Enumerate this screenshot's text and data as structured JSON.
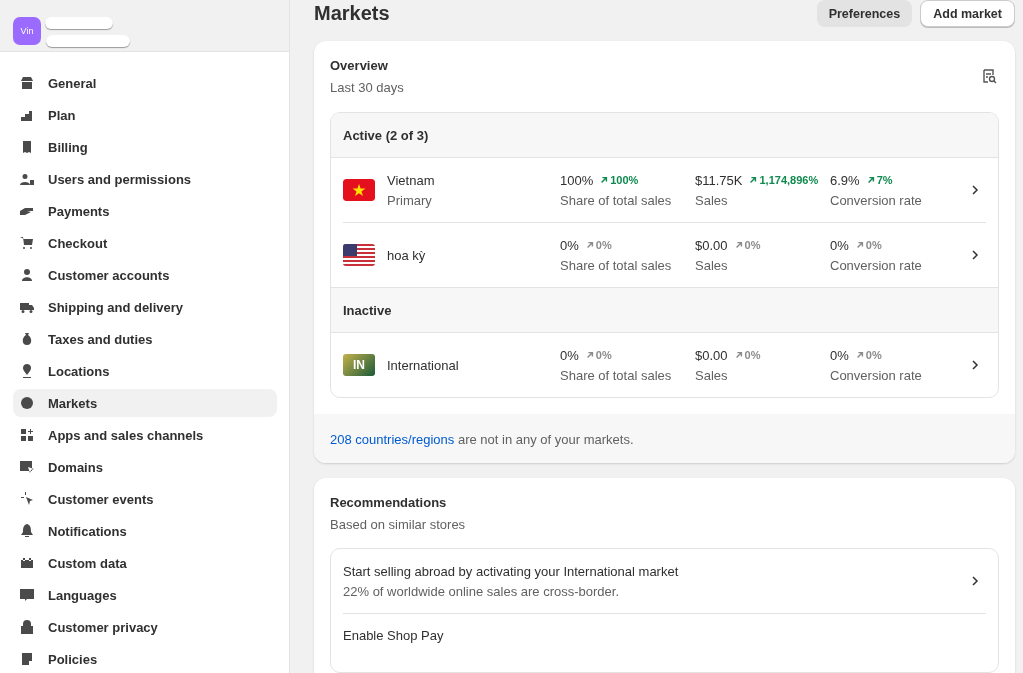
{
  "store": {
    "avatar": "Vin"
  },
  "sidebar": {
    "items": [
      {
        "label": "General",
        "selected": false
      },
      {
        "label": "Plan",
        "selected": false
      },
      {
        "label": "Billing",
        "selected": false
      },
      {
        "label": "Users and permissions",
        "selected": false
      },
      {
        "label": "Payments",
        "selected": false
      },
      {
        "label": "Checkout",
        "selected": false
      },
      {
        "label": "Customer accounts",
        "selected": false
      },
      {
        "label": "Shipping and delivery",
        "selected": false
      },
      {
        "label": "Taxes and duties",
        "selected": false
      },
      {
        "label": "Locations",
        "selected": false
      },
      {
        "label": "Markets",
        "selected": true
      },
      {
        "label": "Apps and sales channels",
        "selected": false
      },
      {
        "label": "Domains",
        "selected": false
      },
      {
        "label": "Customer events",
        "selected": false
      },
      {
        "label": "Notifications",
        "selected": false
      },
      {
        "label": "Custom data",
        "selected": false
      },
      {
        "label": "Languages",
        "selected": false
      },
      {
        "label": "Customer privacy",
        "selected": false
      },
      {
        "label": "Policies",
        "selected": false
      }
    ]
  },
  "page": {
    "title": "Markets",
    "buttons": [
      {
        "label": "Preferences",
        "kind": "secondary"
      },
      {
        "label": "Add market",
        "kind": "primary"
      }
    ]
  },
  "overview": {
    "title": "Overview",
    "subtitle": "Last 30 days",
    "groups": [
      {
        "heading": "Active (2 of 3)",
        "markets": [
          {
            "name": "Vietnam",
            "note": "Primary",
            "kind": "vn",
            "metrics": [
              {
                "value": "100%",
                "change": "100%",
                "positive": true,
                "label": "Share of total sales"
              },
              {
                "value": "$11.75K",
                "change": "1,174,896%",
                "positive": true,
                "label": "Sales"
              },
              {
                "value": "6.9%",
                "change": "7%",
                "positive": true,
                "label": "Conversion rate"
              }
            ]
          },
          {
            "name": "hoa kỳ",
            "kind": "us",
            "metrics": [
              {
                "value": "0%",
                "change": "0%",
                "positive": false,
                "label": "Share of total sales"
              },
              {
                "value": "$0.00",
                "change": "0%",
                "positive": false,
                "label": "Sales"
              },
              {
                "value": "0%",
                "change": "0%",
                "positive": false,
                "label": "Conversion rate"
              }
            ]
          }
        ]
      },
      {
        "heading": "Inactive",
        "markets": [
          {
            "name": "International",
            "kind": "initials",
            "badge": "IN",
            "metrics": [
              {
                "value": "0%",
                "change": "0%",
                "positive": false,
                "label": "Share of total sales"
              },
              {
                "value": "$0.00",
                "change": "0%",
                "positive": false,
                "label": "Sales"
              },
              {
                "value": "0%",
                "change": "0%",
                "positive": false,
                "label": "Conversion rate"
              }
            ]
          }
        ]
      }
    ],
    "footer_link": "208 countries/regions",
    "footer_text": "are not in any of your markets."
  },
  "recommendations": {
    "title": "Recommendations",
    "subtitle": "Based on similar stores",
    "items": [
      {
        "title": "Start selling abroad by activating your International market",
        "description": "22% of worldwide online sales are cross-border."
      },
      {
        "title": "Enable Shop Pay"
      }
    ]
  }
}
